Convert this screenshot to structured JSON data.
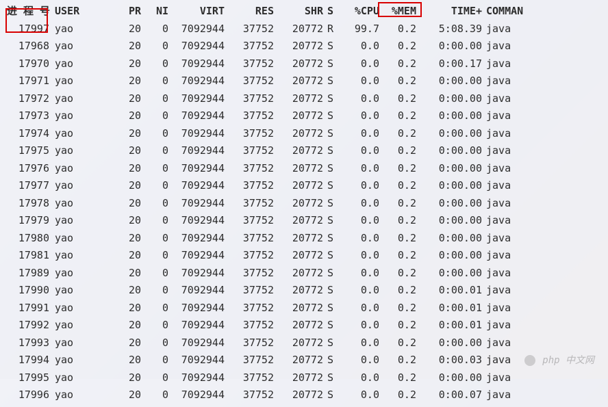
{
  "headers": {
    "pid": "进 程 号",
    "user": "USER",
    "pr": "PR",
    "ni": "NI",
    "virt": "VIRT",
    "res": "RES",
    "shr": "SHR",
    "s": "S",
    "cpu": "%CPU",
    "mem": "%MEM",
    "time": "TIME+",
    "command": "COMMAN"
  },
  "rows": [
    {
      "pid": "17997",
      "user": "yao",
      "pr": "20",
      "ni": "0",
      "virt": "7092944",
      "res": "37752",
      "shr": "20772",
      "s": "R",
      "cpu": "99.7",
      "mem": "0.2",
      "time": "5:08.39",
      "cmd": "java"
    },
    {
      "pid": "17968",
      "user": "yao",
      "pr": "20",
      "ni": "0",
      "virt": "7092944",
      "res": "37752",
      "shr": "20772",
      "s": "S",
      "cpu": "0.0",
      "mem": "0.2",
      "time": "0:00.00",
      "cmd": "java"
    },
    {
      "pid": "17970",
      "user": "yao",
      "pr": "20",
      "ni": "0",
      "virt": "7092944",
      "res": "37752",
      "shr": "20772",
      "s": "S",
      "cpu": "0.0",
      "mem": "0.2",
      "time": "0:00.17",
      "cmd": "java"
    },
    {
      "pid": "17971",
      "user": "yao",
      "pr": "20",
      "ni": "0",
      "virt": "7092944",
      "res": "37752",
      "shr": "20772",
      "s": "S",
      "cpu": "0.0",
      "mem": "0.2",
      "time": "0:00.00",
      "cmd": "java"
    },
    {
      "pid": "17972",
      "user": "yao",
      "pr": "20",
      "ni": "0",
      "virt": "7092944",
      "res": "37752",
      "shr": "20772",
      "s": "S",
      "cpu": "0.0",
      "mem": "0.2",
      "time": "0:00.00",
      "cmd": "java"
    },
    {
      "pid": "17973",
      "user": "yao",
      "pr": "20",
      "ni": "0",
      "virt": "7092944",
      "res": "37752",
      "shr": "20772",
      "s": "S",
      "cpu": "0.0",
      "mem": "0.2",
      "time": "0:00.00",
      "cmd": "java"
    },
    {
      "pid": "17974",
      "user": "yao",
      "pr": "20",
      "ni": "0",
      "virt": "7092944",
      "res": "37752",
      "shr": "20772",
      "s": "S",
      "cpu": "0.0",
      "mem": "0.2",
      "time": "0:00.00",
      "cmd": "java"
    },
    {
      "pid": "17975",
      "user": "yao",
      "pr": "20",
      "ni": "0",
      "virt": "7092944",
      "res": "37752",
      "shr": "20772",
      "s": "S",
      "cpu": "0.0",
      "mem": "0.2",
      "time": "0:00.00",
      "cmd": "java"
    },
    {
      "pid": "17976",
      "user": "yao",
      "pr": "20",
      "ni": "0",
      "virt": "7092944",
      "res": "37752",
      "shr": "20772",
      "s": "S",
      "cpu": "0.0",
      "mem": "0.2",
      "time": "0:00.00",
      "cmd": "java"
    },
    {
      "pid": "17977",
      "user": "yao",
      "pr": "20",
      "ni": "0",
      "virt": "7092944",
      "res": "37752",
      "shr": "20772",
      "s": "S",
      "cpu": "0.0",
      "mem": "0.2",
      "time": "0:00.00",
      "cmd": "java"
    },
    {
      "pid": "17978",
      "user": "yao",
      "pr": "20",
      "ni": "0",
      "virt": "7092944",
      "res": "37752",
      "shr": "20772",
      "s": "S",
      "cpu": "0.0",
      "mem": "0.2",
      "time": "0:00.00",
      "cmd": "java"
    },
    {
      "pid": "17979",
      "user": "yao",
      "pr": "20",
      "ni": "0",
      "virt": "7092944",
      "res": "37752",
      "shr": "20772",
      "s": "S",
      "cpu": "0.0",
      "mem": "0.2",
      "time": "0:00.00",
      "cmd": "java"
    },
    {
      "pid": "17980",
      "user": "yao",
      "pr": "20",
      "ni": "0",
      "virt": "7092944",
      "res": "37752",
      "shr": "20772",
      "s": "S",
      "cpu": "0.0",
      "mem": "0.2",
      "time": "0:00.00",
      "cmd": "java"
    },
    {
      "pid": "17981",
      "user": "yao",
      "pr": "20",
      "ni": "0",
      "virt": "7092944",
      "res": "37752",
      "shr": "20772",
      "s": "S",
      "cpu": "0.0",
      "mem": "0.2",
      "time": "0:00.00",
      "cmd": "java"
    },
    {
      "pid": "17989",
      "user": "yao",
      "pr": "20",
      "ni": "0",
      "virt": "7092944",
      "res": "37752",
      "shr": "20772",
      "s": "S",
      "cpu": "0.0",
      "mem": "0.2",
      "time": "0:00.00",
      "cmd": "java"
    },
    {
      "pid": "17990",
      "user": "yao",
      "pr": "20",
      "ni": "0",
      "virt": "7092944",
      "res": "37752",
      "shr": "20772",
      "s": "S",
      "cpu": "0.0",
      "mem": "0.2",
      "time": "0:00.01",
      "cmd": "java"
    },
    {
      "pid": "17991",
      "user": "yao",
      "pr": "20",
      "ni": "0",
      "virt": "7092944",
      "res": "37752",
      "shr": "20772",
      "s": "S",
      "cpu": "0.0",
      "mem": "0.2",
      "time": "0:00.01",
      "cmd": "java"
    },
    {
      "pid": "17992",
      "user": "yao",
      "pr": "20",
      "ni": "0",
      "virt": "7092944",
      "res": "37752",
      "shr": "20772",
      "s": "S",
      "cpu": "0.0",
      "mem": "0.2",
      "time": "0:00.01",
      "cmd": "java"
    },
    {
      "pid": "17993",
      "user": "yao",
      "pr": "20",
      "ni": "0",
      "virt": "7092944",
      "res": "37752",
      "shr": "20772",
      "s": "S",
      "cpu": "0.0",
      "mem": "0.2",
      "time": "0:00.00",
      "cmd": "java"
    },
    {
      "pid": "17994",
      "user": "yao",
      "pr": "20",
      "ni": "0",
      "virt": "7092944",
      "res": "37752",
      "shr": "20772",
      "s": "S",
      "cpu": "0.0",
      "mem": "0.2",
      "time": "0:00.03",
      "cmd": "java"
    },
    {
      "pid": "17995",
      "user": "yao",
      "pr": "20",
      "ni": "0",
      "virt": "7092944",
      "res": "37752",
      "shr": "20772",
      "s": "S",
      "cpu": "0.0",
      "mem": "0.2",
      "time": "0:00.00",
      "cmd": "java"
    },
    {
      "pid": "17996",
      "user": "yao",
      "pr": "20",
      "ni": "0",
      "virt": "7092944",
      "res": "37752",
      "shr": "20772",
      "s": "S",
      "cpu": "0.0",
      "mem": "0.2",
      "time": "0:00.07",
      "cmd": "java"
    }
  ],
  "watermark": "php 中文网"
}
